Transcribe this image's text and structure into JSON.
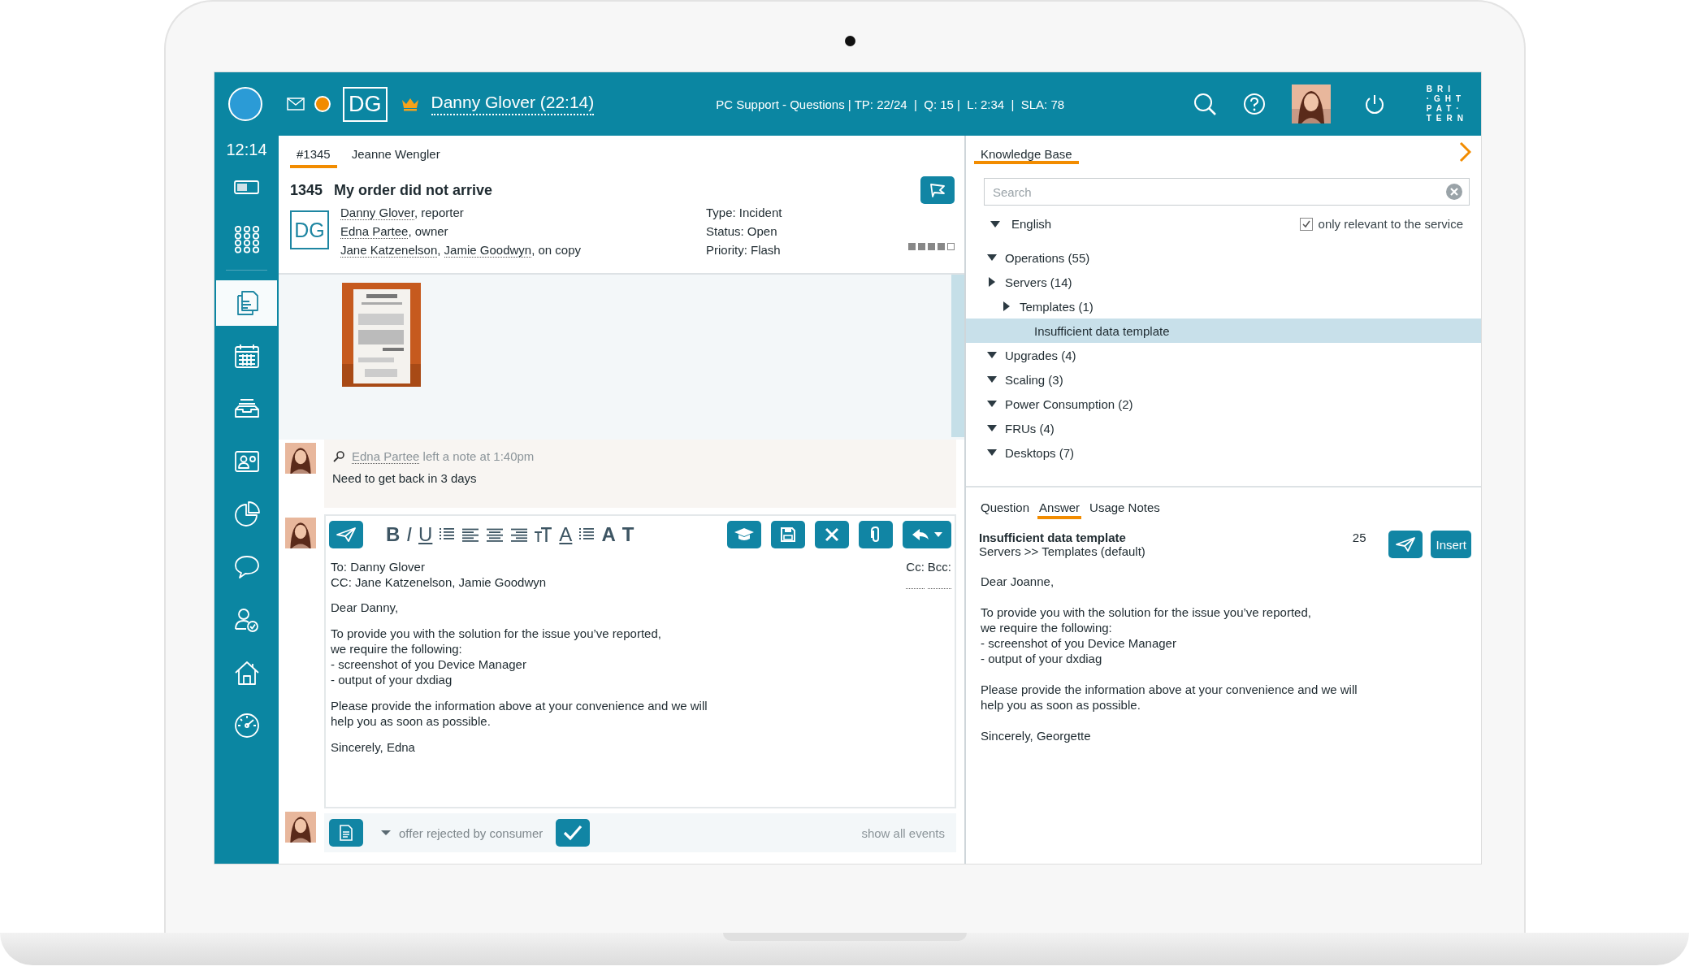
{
  "top_bar": {
    "initials": "DG",
    "agent": "Danny Glover (22:14)",
    "queue_stats": "PC Support - Questions | TP: 22/24  |  Q: 15 |  L: 2:34  |  SLA: 78",
    "logo": [
      "BRI",
      "·GHT",
      "PAT·",
      "TERN"
    ]
  },
  "sidebar": {
    "clock": "12:14",
    "top_items": [
      {
        "kind": "toggle",
        "selected": false
      },
      {
        "kind": "dialpad",
        "selected": false
      }
    ],
    "items": [
      {
        "kind": "documents",
        "selected": true
      },
      {
        "kind": "calendar",
        "selected": false
      },
      {
        "kind": "tray",
        "selected": false
      },
      {
        "kind": "contact",
        "selected": false
      },
      {
        "kind": "chart",
        "selected": false
      },
      {
        "kind": "chat",
        "selected": false
      },
      {
        "kind": "user-check",
        "selected": false
      },
      {
        "kind": "home",
        "selected": false
      },
      {
        "kind": "gauge",
        "selected": false
      }
    ]
  },
  "ticket_tabs": [
    {
      "label": "#1345",
      "selected": true
    },
    {
      "label": "Jeanne Wengler",
      "selected": false
    }
  ],
  "ticket": {
    "number": "1345",
    "subject": "My order did not arrive",
    "initials": "DG",
    "participants": [
      {
        "parts": [
          {
            "kind": "link",
            "text": "Danny Glover"
          },
          {
            "kind": "plain",
            "text": ", reporter"
          }
        ]
      },
      {
        "parts": [
          {
            "kind": "link",
            "text": "Edna Partee"
          },
          {
            "kind": "plain",
            "text": ", owner"
          }
        ]
      },
      {
        "parts": [
          {
            "kind": "link",
            "text": "Jane Katzenelson"
          },
          {
            "kind": "plain",
            "text": ", "
          },
          {
            "kind": "link",
            "text": "Jamie Goodwyn"
          },
          {
            "kind": "plain",
            "text": ", on copy"
          }
        ]
      }
    ],
    "fields": [
      "Type: Incident",
      "Status: Open",
      "Priority: Flash"
    ],
    "priority": {
      "level": 0.8
    }
  },
  "note": {
    "author": "Edna Partee",
    "text": " left a note at 1:40pm",
    "body": "Need to get back in 3 days"
  },
  "composer": {
    "format_tools": [
      {
        "kind": "bold",
        "label": "B"
      },
      {
        "kind": "italic",
        "label": "I"
      },
      {
        "kind": "underline",
        "label": "U"
      },
      {
        "kind": "bullets"
      },
      {
        "kind": "align-left"
      },
      {
        "kind": "align-center"
      },
      {
        "kind": "align-right"
      },
      {
        "kind": "text-size"
      },
      {
        "kind": "font-color",
        "label": "A"
      },
      {
        "kind": "numbered"
      },
      {
        "kind": "letter",
        "label": "A"
      },
      {
        "kind": "letter",
        "label": "T"
      }
    ],
    "to": "To: Danny Glover",
    "cc": "CC: Jane Katzenelson, Jamie Goodwyn",
    "cc_links": [
      "Cc:",
      "Bcc:"
    ],
    "body": [
      [
        "Dear Danny,"
      ],
      [
        "To provide you with the solution for the issue you’ve reported,",
        "we require the following:",
        "- screenshot of you Device Manager",
        "- output of your dxdiag"
      ],
      [
        "Please provide the information above at your convenience and we will",
        "help you as soon as possible."
      ],
      [
        "Sincerely, Edna"
      ]
    ]
  },
  "footer": {
    "event": "offer rejected by consumer",
    "show_all": "show all events"
  },
  "knowledge_base": {
    "tab": {
      "label": "Knowledge Base",
      "selected": true
    },
    "search": {
      "placeholder": "Search"
    },
    "language": {
      "label": "English",
      "expanded": true
    },
    "relevant_only": {
      "label": "only relevant to the service",
      "checked": true
    },
    "tree": [
      {
        "label": "Operations (55)",
        "expanded": true,
        "selected": false
      },
      {
        "label": "Servers (14)",
        "expanded": false,
        "selected": false,
        "children": [
          {
            "label": "Templates (1)",
            "expanded": false,
            "selected": false,
            "children": [
              {
                "label": "Insufficient data template",
                "selected": true
              }
            ]
          }
        ]
      },
      {
        "label": "Upgrades (4)",
        "expanded": true,
        "selected": false
      },
      {
        "label": "Scaling (3)",
        "expanded": true,
        "selected": false
      },
      {
        "label": "Power Consumption (2)",
        "expanded": true,
        "selected": false
      },
      {
        "label": "FRUs (4)",
        "expanded": true,
        "selected": false
      },
      {
        "label": "Desktops (7)",
        "expanded": true,
        "selected": false
      }
    ],
    "article_tabs": [
      {
        "label": "Question",
        "selected": false
      },
      {
        "label": "Answer",
        "selected": true
      },
      {
        "label": "Usage Notes",
        "selected": false
      }
    ],
    "answer": {
      "title": "Insufficient data template",
      "path": "Servers >> Templates (default)",
      "count": "25",
      "insert": "Insert",
      "body": [
        [
          "Dear Joanne,"
        ],
        [
          "To provide you with the solution for the issue you’ve reported,",
          "we require the following:",
          "- screenshot of you Device Manager",
          "- output of your dxdiag"
        ],
        [
          "Please provide the information above at your convenience and we will",
          "help you as soon as possible."
        ],
        [
          "Sincerely, Georgette"
        ]
      ]
    }
  }
}
